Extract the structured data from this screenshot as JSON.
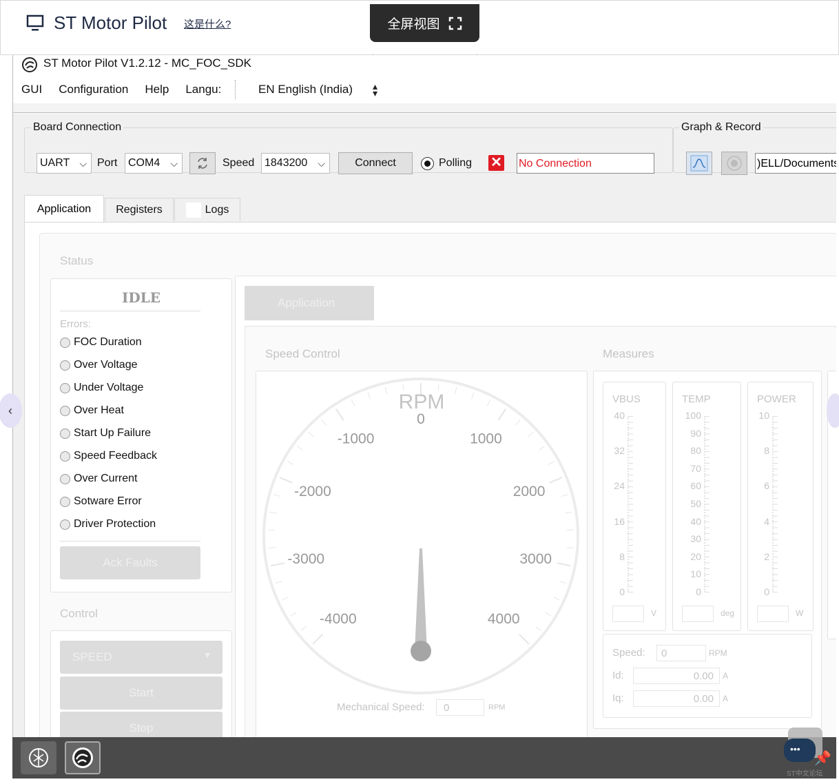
{
  "page": {
    "title": "ST Motor Pilot",
    "whatis_link": "这是什么?",
    "fullscreen_label": "全屏视图"
  },
  "app": {
    "window_title": "ST Motor Pilot V1.2.12 - MC_FOC_SDK",
    "menu": [
      "GUI",
      "Configuration",
      "Help",
      "Langu:"
    ],
    "language_value": "EN English (India)"
  },
  "board_connection": {
    "group_title": "Board Connection",
    "interface": "UART",
    "port_label": "Port",
    "port": "COM4",
    "speed_label": "Speed",
    "speed": "1843200",
    "connect_label": "Connect",
    "polling_label": "Polling",
    "status_text": "No Connection",
    "status_color": "#e01b24"
  },
  "graph_record": {
    "group_title": "Graph & Record",
    "path": ")ELL/Documents/"
  },
  "tabs": [
    "Application",
    "Registers",
    "Logs"
  ],
  "status_panel": {
    "title": "Status",
    "state": "IDLE",
    "errors_label": "Errors:",
    "errors": [
      "FOC Duration",
      "Over Voltage",
      "Under Voltage",
      "Over Heat",
      "Start Up Failure",
      "Speed Feedback",
      "Over Current",
      "Sotware Error",
      "Driver Protection"
    ],
    "ack_faults": "Ack Faults"
  },
  "control_panel": {
    "title": "Control",
    "mode": "SPEED",
    "start": "Start",
    "stop": "Stop"
  },
  "application_tab": {
    "label": "Application",
    "speed_control_title": "Speed Control",
    "measures_title": "Measures"
  },
  "gauge": {
    "unit": "RPM",
    "labels": [
      "-4000",
      "-3000",
      "-2000",
      "-1000",
      "0",
      "1000",
      "2000",
      "3000",
      "4000"
    ],
    "min": -4000,
    "max": 4000,
    "value": 0,
    "mech_speed_label": "Mechanical Speed:",
    "mech_speed_value": "0",
    "mech_speed_unit": "RPM"
  },
  "measures": {
    "vbus": {
      "title": "VBUS",
      "ticks": [
        "40",
        "32",
        "24",
        "16",
        "8",
        "0"
      ],
      "unit": "V"
    },
    "temp": {
      "title": "TEMP",
      "ticks": [
        "100",
        "90",
        "80",
        "70",
        "60",
        "50",
        "40",
        "30",
        "20",
        "10",
        "0"
      ],
      "unit": "deg"
    },
    "power": {
      "title": "POWER",
      "ticks": [
        "10",
        "8",
        "6",
        "4",
        "2",
        "0"
      ],
      "unit": "W"
    },
    "speed_label": "Speed:",
    "speed_value": "0",
    "speed_unit": "RPM",
    "id_label": "Id:",
    "id_value": "0.00",
    "id_unit": "A",
    "iq_label": "Iq:",
    "iq_value": "0.00",
    "iq_unit": "A"
  },
  "footer": {
    "watermark": "ST中文论坛"
  }
}
